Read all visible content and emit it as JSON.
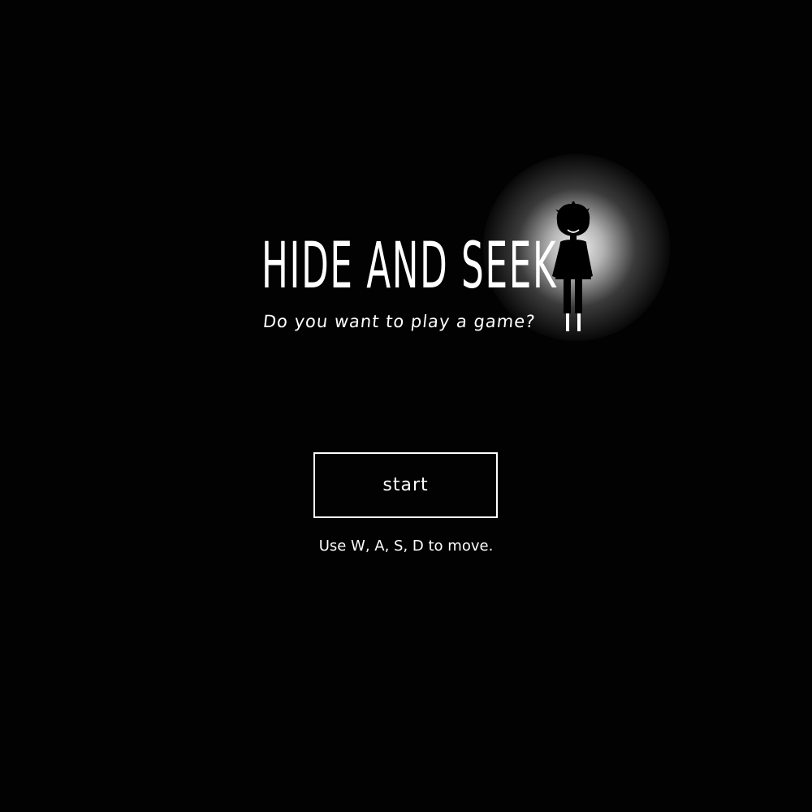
{
  "game": {
    "title": "HIDE AND SEEK",
    "subtitle": "Do you want to play a game?",
    "start_label": "start",
    "hint": "Use W, A, S, D to move."
  },
  "colors": {
    "background": "#020202",
    "text": "#ffffff",
    "glow": "#ffffff",
    "figure": "#000000"
  },
  "icons": {
    "character": "child-silhouette-icon"
  }
}
